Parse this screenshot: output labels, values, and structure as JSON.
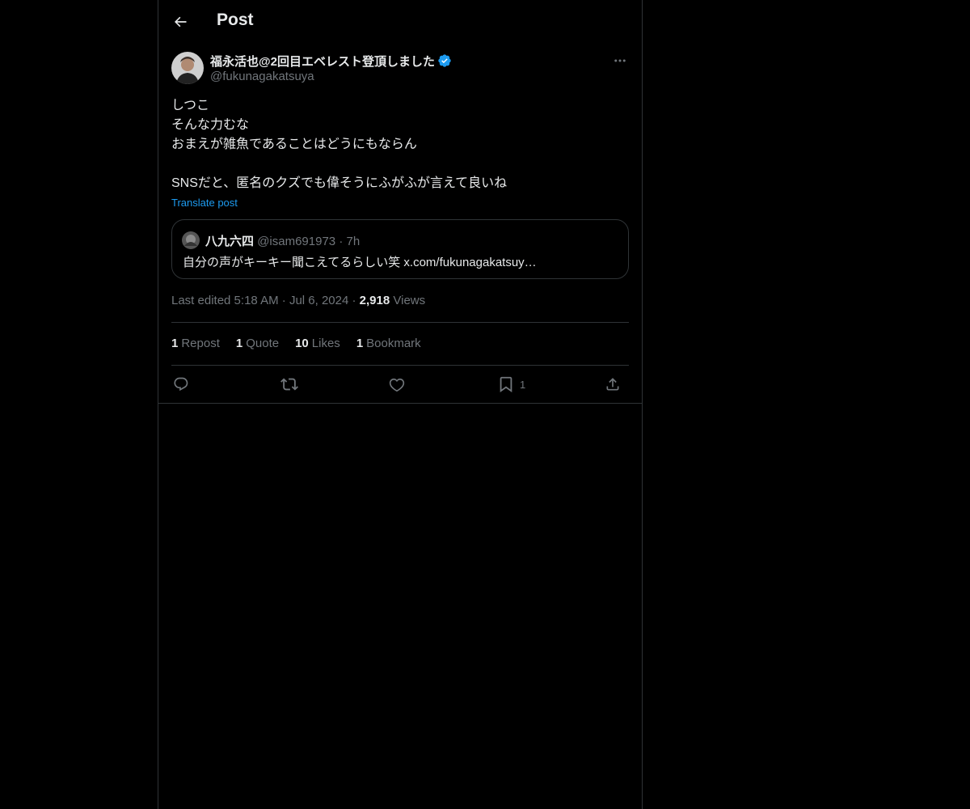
{
  "header": {
    "title": "Post",
    "back_icon": "arrow-left-icon"
  },
  "author": {
    "display_name": "福永活也@2回目エベレスト登頂しました",
    "handle": "@fukunagakatsuya",
    "verified": true,
    "verified_color": "#1d9bf0"
  },
  "post": {
    "lines": [
      "しつこ",
      "そんな力むな",
      "おまえが雑魚であることはどうにもならん",
      "",
      "SNSだと、匿名のクズでも偉そうにふがふが言えて良いね"
    ],
    "translate_label": "Translate post"
  },
  "quote": {
    "name": "八九六四",
    "handle": "@isam691973",
    "separator": "·",
    "time": "7h",
    "text": "自分の声がキーキー聞こえてるらしい笑 x.com/fukunagakatsuy…"
  },
  "meta": {
    "edited_label": "Last edited 5:18 AM",
    "sep1": "·",
    "date": "Jul 6, 2024",
    "sep2": "·",
    "views_count": "2,918",
    "views_label": "Views"
  },
  "stats": [
    {
      "num": "1",
      "label": "Repost"
    },
    {
      "num": "1",
      "label": "Quote"
    },
    {
      "num": "10",
      "label": "Likes"
    },
    {
      "num": "1",
      "label": "Bookmark"
    }
  ],
  "actions": {
    "reply_icon": "reply-icon",
    "repost_icon": "repost-icon",
    "like_icon": "heart-icon",
    "bookmark_icon": "bookmark-icon",
    "bookmark_count": "1",
    "share_icon": "share-icon"
  },
  "colors": {
    "background": "#000000",
    "text": "#e7e9ea",
    "muted": "#71767b",
    "link": "#1d9bf0",
    "border": "#2f3336"
  }
}
